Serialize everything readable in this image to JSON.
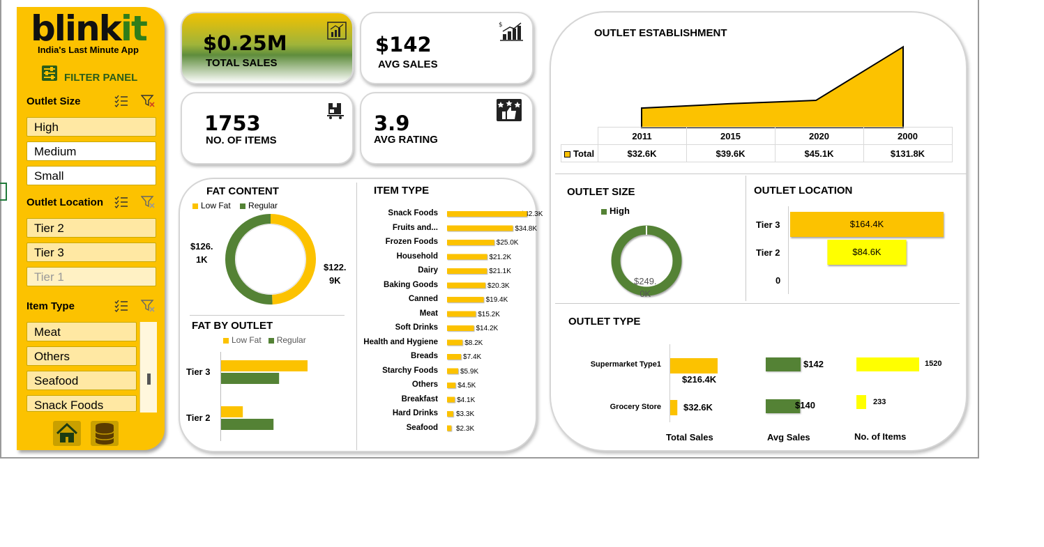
{
  "sidebar": {
    "logo_main": "blink",
    "logo_accent": "it",
    "tagline": "India's Last Minute App",
    "filter_panel": "FILTER PANEL",
    "outlet_size": {
      "title": "Outlet Size",
      "items": [
        "High",
        "Medium",
        "Small"
      ]
    },
    "outlet_location": {
      "title": "Outlet Location",
      "items": [
        "Tier 2",
        "Tier 3",
        "Tier 1"
      ]
    },
    "item_type": {
      "title": "Item Type",
      "items": [
        "Meat",
        "Others",
        "Seafood",
        "Snack Foods"
      ]
    }
  },
  "kpis": {
    "total_sales": {
      "value": "$0.25M",
      "label": "TOTAL SALES"
    },
    "avg_sales": {
      "value": "$142",
      "label": "AVG SALES"
    },
    "items": {
      "value": "1753",
      "label": "NO. OF ITEMS"
    },
    "avg_rating": {
      "value": "3.9",
      "label": "AVG RATING"
    }
  },
  "fat_content": {
    "title": "FAT CONTENT",
    "legend": [
      "Low Fat",
      "Regular"
    ],
    "label_left": [
      "$126.",
      "1K"
    ],
    "label_right": [
      "$122.",
      "9K"
    ]
  },
  "fat_by_outlet": {
    "title": "FAT BY OUTLET",
    "legend": [
      "Low Fat",
      "Regular"
    ],
    "rows": [
      "Tier 3",
      "Tier 2"
    ]
  },
  "item_type_chart": {
    "title": "ITEM TYPE",
    "rows": [
      {
        "name": "Snack Foods",
        "label": "$42.3K"
      },
      {
        "name": "Fruits and...",
        "label": "$34.8K"
      },
      {
        "name": "Frozen Foods",
        "label": "$25.0K"
      },
      {
        "name": "Household",
        "label": "$21.2K"
      },
      {
        "name": "Dairy",
        "label": "$21.1K"
      },
      {
        "name": "Baking Goods",
        "label": "$20.3K"
      },
      {
        "name": "Canned",
        "label": "$19.4K"
      },
      {
        "name": "Meat",
        "label": "$15.2K"
      },
      {
        "name": "Soft Drinks",
        "label": "$14.2K"
      },
      {
        "name": "Health and Hygiene",
        "label": "$8.2K"
      },
      {
        "name": "Breads",
        "label": "$7.4K"
      },
      {
        "name": "Starchy Foods",
        "label": "$5.9K"
      },
      {
        "name": "Others",
        "label": "$4.5K"
      },
      {
        "name": "Breakfast",
        "label": "$4.1K"
      },
      {
        "name": "Hard Drinks",
        "label": "$3.3K"
      },
      {
        "name": "Seafood",
        "label": "$2.3K"
      }
    ]
  },
  "outlet_establishment": {
    "title": "OUTLET ESTABLISHMENT",
    "years": [
      "2011",
      "2015",
      "2020",
      "2000"
    ],
    "row_label": "Total",
    "values": [
      "$32.6K",
      "$39.6K",
      "$45.1K",
      "$131.8K"
    ]
  },
  "outlet_size_chart": {
    "title": "OUTLET SIZE",
    "legend": "High",
    "label": [
      "$249.",
      "0K"
    ]
  },
  "outlet_location_chart": {
    "title": "OUTLET LOCATION",
    "rows": [
      {
        "name": "Tier 3",
        "label": "$164.4K"
      },
      {
        "name": "Tier 2",
        "label": "$84.6K"
      },
      {
        "name": "0",
        "label": ""
      }
    ]
  },
  "outlet_type": {
    "title": "OUTLET TYPE",
    "rows": [
      {
        "name": "Supermarket Type1",
        "sales": "$216.4K",
        "avg": "$142",
        "items": "1520"
      },
      {
        "name": "Grocery Store",
        "sales": "$32.6K",
        "avg": "$140",
        "items": "233"
      }
    ],
    "columns": [
      "Total Sales",
      "Avg Sales",
      "No. of Items"
    ]
  },
  "chart_data": [
    {
      "type": "pie",
      "title": "FAT CONTENT",
      "categories": [
        "Low Fat",
        "Regular"
      ],
      "values": [
        122.9,
        126.1
      ],
      "unit": "$K"
    },
    {
      "type": "bar",
      "title": "FAT BY OUTLET",
      "categories": [
        "Tier 3",
        "Tier 2"
      ],
      "series": [
        {
          "name": "Low Fat",
          "values": [
            77.5,
            19.5
          ]
        },
        {
          "name": "Regular",
          "values": [
            52.0,
            47.0
          ]
        }
      ]
    },
    {
      "type": "bar",
      "title": "ITEM TYPE",
      "categories": [
        "Snack Foods",
        "Fruits and...",
        "Frozen Foods",
        "Household",
        "Dairy",
        "Baking Goods",
        "Canned",
        "Meat",
        "Soft Drinks",
        "Health and Hygiene",
        "Breads",
        "Starchy Foods",
        "Others",
        "Breakfast",
        "Hard Drinks",
        "Seafood"
      ],
      "values": [
        42.3,
        34.8,
        25.0,
        21.2,
        21.1,
        20.3,
        19.4,
        15.2,
        14.2,
        8.2,
        7.4,
        5.9,
        4.5,
        4.1,
        3.3,
        2.3
      ],
      "unit": "$K"
    },
    {
      "type": "area",
      "title": "OUTLET ESTABLISHMENT",
      "categories": [
        "2011",
        "2015",
        "2020",
        "2000"
      ],
      "values": [
        32.6,
        39.6,
        45.1,
        131.8
      ],
      "unit": "$K"
    },
    {
      "type": "pie",
      "title": "OUTLET SIZE",
      "categories": [
        "High"
      ],
      "values": [
        249.0
      ],
      "unit": "$K"
    },
    {
      "type": "bar",
      "title": "OUTLET LOCATION",
      "categories": [
        "Tier 3",
        "Tier 2"
      ],
      "values": [
        164.4,
        84.6
      ],
      "unit": "$K"
    },
    {
      "type": "bar",
      "title": "OUTLET TYPE",
      "categories": [
        "Supermarket Type1",
        "Grocery Store"
      ],
      "series": [
        {
          "name": "Total Sales",
          "values": [
            216.4,
            32.6
          ]
        },
        {
          "name": "Avg Sales",
          "values": [
            142,
            140
          ]
        },
        {
          "name": "No. of Items",
          "values": [
            1520,
            233
          ]
        }
      ]
    }
  ],
  "colors": {
    "yellow": "#fcc200",
    "green": "#548235",
    "bright_yellow": "#ffff00"
  }
}
